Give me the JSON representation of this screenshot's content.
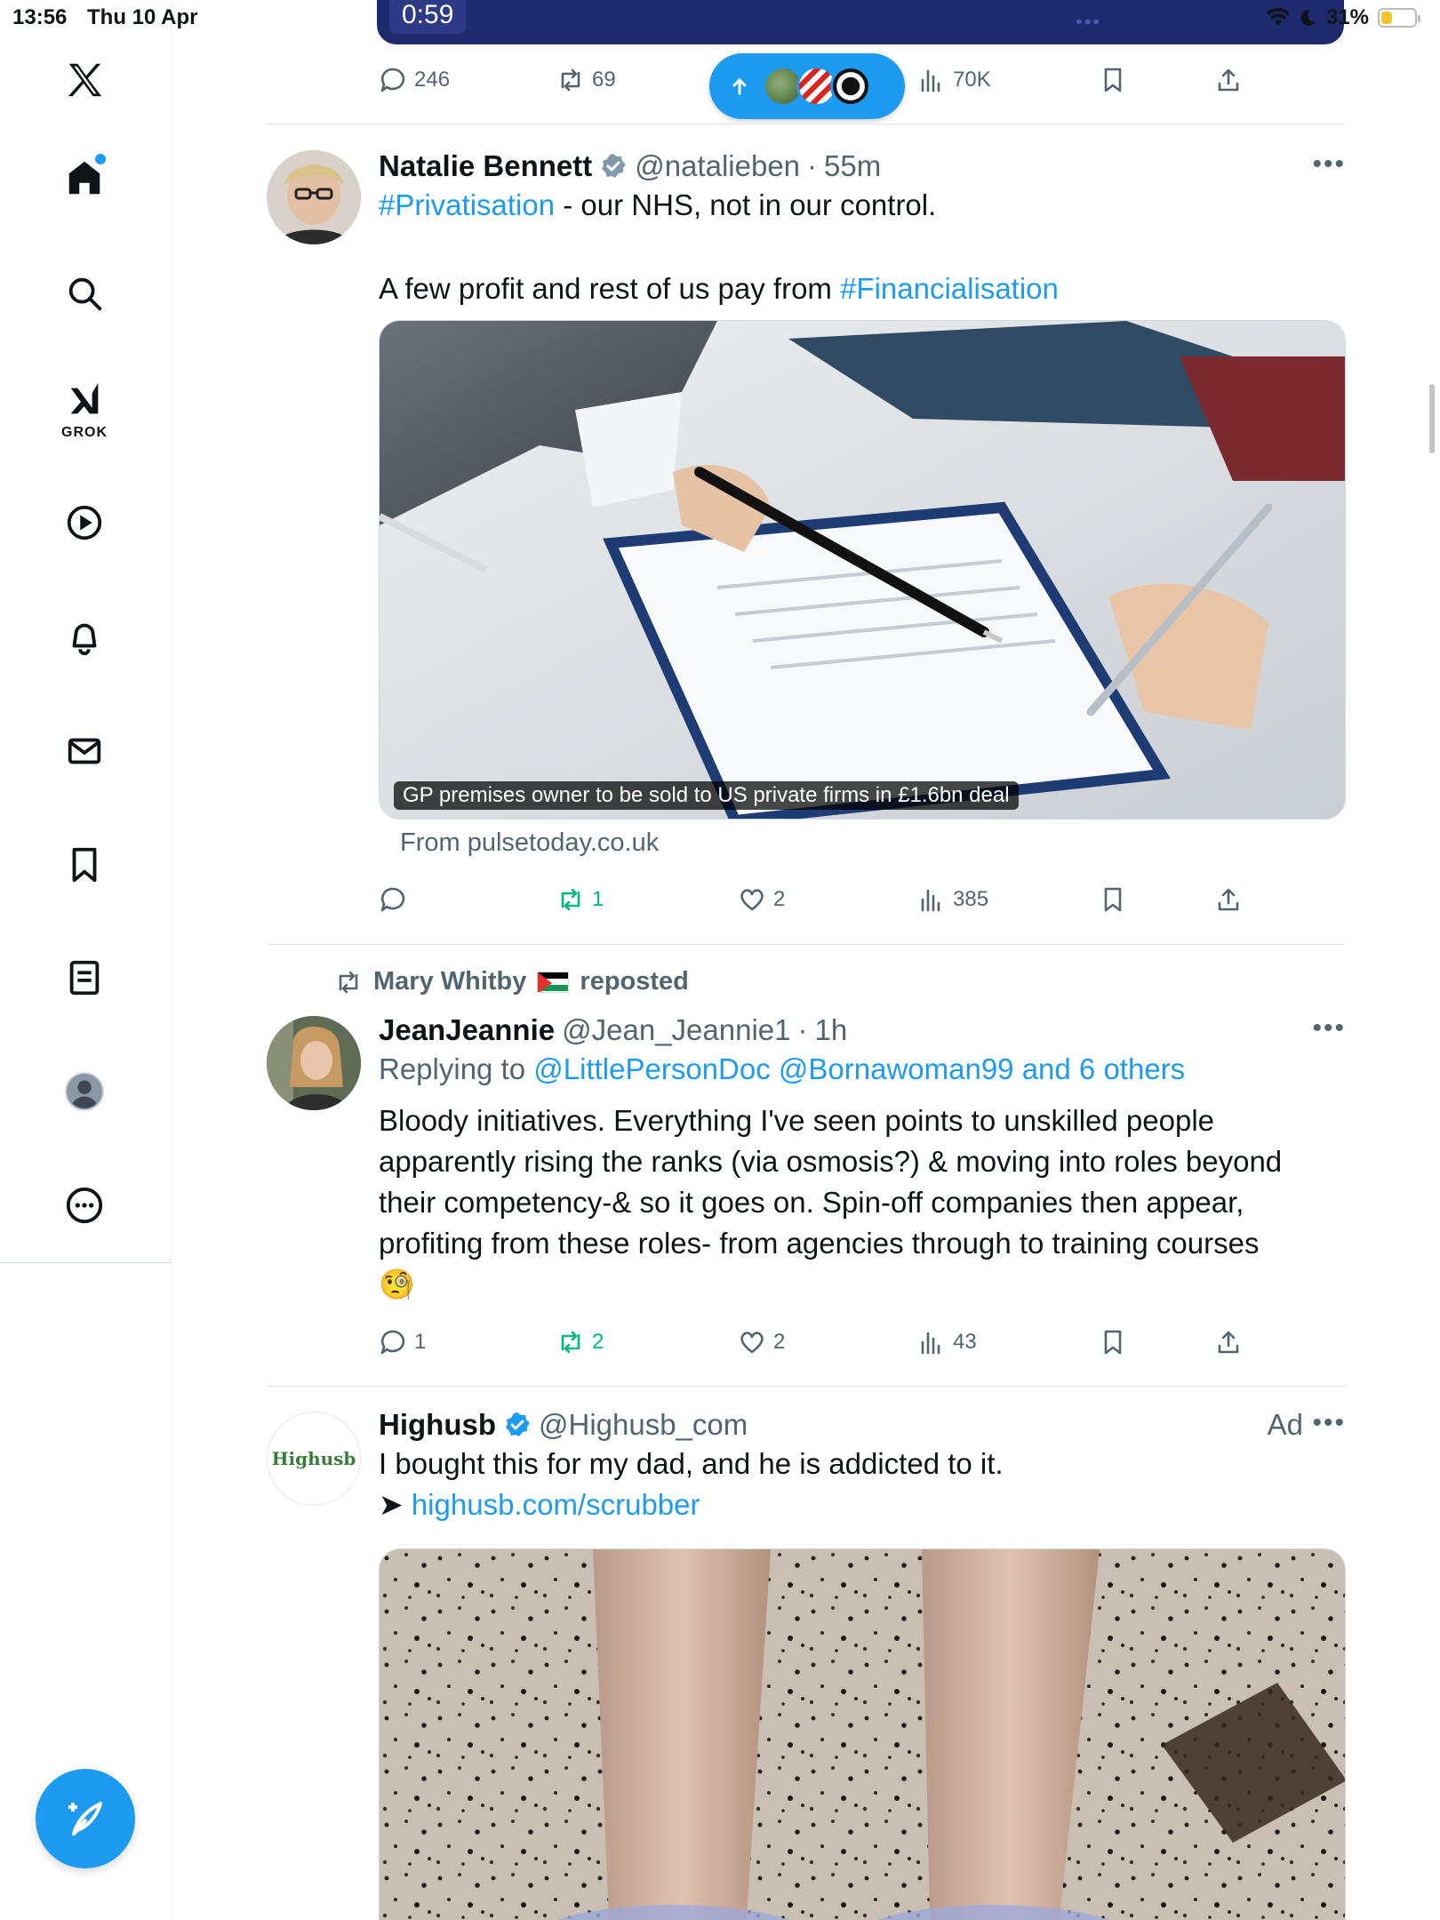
{
  "status_bar": {
    "time": "13:56",
    "date": "Thu 10 Apr",
    "battery": "31%",
    "battery_level": 0.31
  },
  "sidebar": {
    "logo": "x-logo-icon",
    "items": [
      {
        "name": "home",
        "icon": "home-icon"
      },
      {
        "name": "explore",
        "icon": "search-icon"
      },
      {
        "name": "grok",
        "icon": "grok-icon",
        "label": "GROK"
      },
      {
        "name": "videos",
        "icon": "play-icon"
      },
      {
        "name": "notifications",
        "icon": "bell-icon"
      },
      {
        "name": "messages",
        "icon": "mail-icon"
      },
      {
        "name": "bookmarks",
        "icon": "bookmark-icon"
      },
      {
        "name": "lists",
        "icon": "list-icon"
      },
      {
        "name": "profile",
        "icon": "avatar-icon"
      },
      {
        "name": "more",
        "icon": "more-circle-icon"
      }
    ],
    "compose_icon": "compose-icon"
  },
  "top_video": {
    "duration": "0:59"
  },
  "top_actions": {
    "replies": "246",
    "reposts": "69",
    "views": "70K"
  },
  "new_posts_pill": {
    "icon": "arrow-up-icon"
  },
  "tweets": [
    {
      "name": "Natalie Bennett",
      "handle": "@natalieben",
      "time": "55m",
      "verified_color": "#829aab",
      "hashtag1": "#Privatisation",
      "line1_rest": " - our NHS, not in our control.",
      "line2_start": "A few profit and rest of us pay from ",
      "hashtag2": "#Financialisation",
      "media_caption": "GP premises owner to be sold to US private firms in £1.6bn deal",
      "from": "From pulsetoday.co.uk",
      "replies": "",
      "reposts": "1",
      "likes": "2",
      "views": "385"
    },
    {
      "reposted_by": "Mary Whitby",
      "reposted_label": "reposted",
      "name": "JeanJeannie",
      "handle": "@Jean_Jeannie1",
      "time": "1h",
      "replying_prefix": "Replying to ",
      "replying_to": "@LittlePersonDoc @Bornawoman99 and 6 others",
      "body_lines": [
        "Bloody initiatives. Everything I've seen points to unskilled people",
        "apparently rising the ranks (via osmosis?) & moving into roles beyond",
        "their competency-& so it goes on. Spin-off companies then appear,",
        "profiting from these roles- from agencies through to training courses"
      ],
      "emoji": "🧐",
      "replies": "1",
      "reposts": "2",
      "likes": "2",
      "views": "43"
    },
    {
      "name": "Highusb",
      "handle": "@Highusb_com",
      "ad_label": "Ad",
      "avatar_text": "Highusb",
      "verified_color": "#1d9bf0",
      "line1": "I bought this for my dad, and he is addicted to it.",
      "arrow": "➤ ",
      "link": "highusb.com/scrubber"
    }
  ],
  "colors": {
    "accent": "#1d9bf0",
    "repost_green": "#00ba7c",
    "muted": "#536471"
  }
}
